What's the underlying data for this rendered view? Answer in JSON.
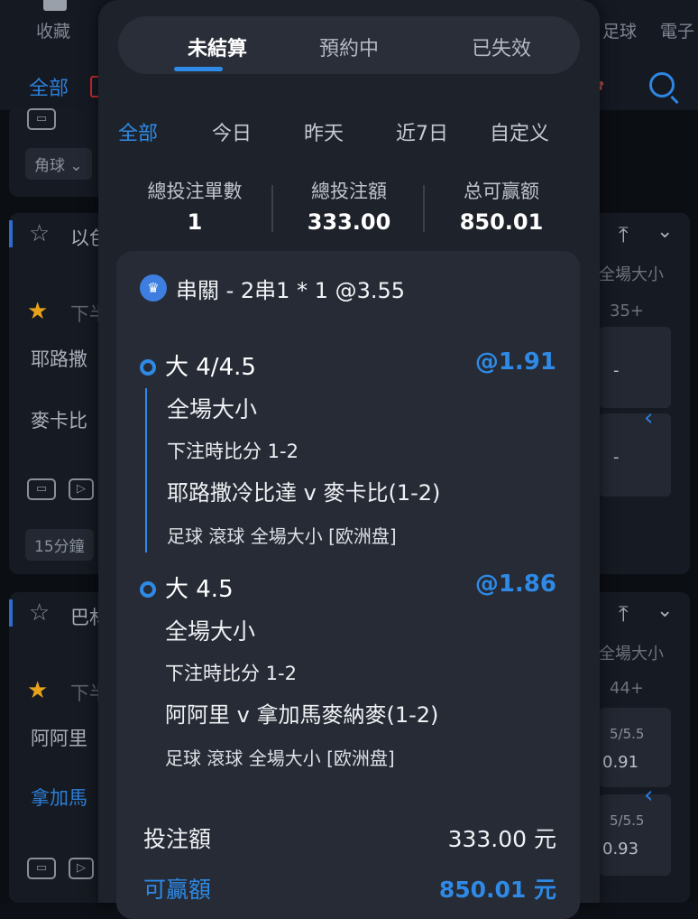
{
  "background": {
    "nav": [
      "收藏",
      "足球",
      "電子"
    ],
    "filter_all": "全部",
    "left_texts": {
      "corner": "角球",
      "team_a": "以色",
      "half1": "下半",
      "match1_home": "耶路撒",
      "match1_away": "麥卡比",
      "time": "15分鐘",
      "team_b": "巴林",
      "half2": "下半",
      "match2_home": "阿阿里",
      "match2_away": "拿加馬"
    },
    "right_texts": {
      "market1": "全場大小",
      "more1": "35+",
      "dash1": "-",
      "dash2": "-",
      "market2": "全場大小",
      "more2": "44+",
      "line1": "5/5.5",
      "odd1": "0.91",
      "line2": "5/5.5",
      "odd2": "0.93"
    }
  },
  "panel": {
    "tabs": [
      "未結算",
      "預約中",
      "已失效"
    ],
    "active_tab": 0,
    "filters": [
      "全部",
      "今日",
      "昨天",
      "近7日",
      "自定义"
    ],
    "active_filter": 0,
    "stats": [
      {
        "label": "總投注單數",
        "value": "1"
      },
      {
        "label": "總投注額",
        "value": "333.00"
      },
      {
        "label": "总可赢额",
        "value": "850.01"
      }
    ],
    "bet": {
      "title": "串關 - 2串1 * 1 @3.55",
      "legs": [
        {
          "pick": "大 4/4.5",
          "odds": "@1.91",
          "market": "全場大小",
          "score": "下注時比分 1-2",
          "match": "耶路撒冷比達 v 麥卡比(1-2)",
          "meta": "足球 滾球   全場大小 [欧洲盘]"
        },
        {
          "pick": "大 4.5",
          "odds": "@1.86",
          "market": "全場大小",
          "score": "下注時比分 1-2",
          "match": "阿阿里 v 拿加馬麥納麥(1-2)",
          "meta": "足球 滾球   全場大小 [欧洲盘]"
        }
      ],
      "stake_label": "投注額",
      "stake_value": "333.00 元",
      "win_label": "可贏額",
      "win_value": "850.01 元"
    },
    "colors": {
      "accent": "#2e8ae6",
      "panel": "#1e222b",
      "card": "#262b35"
    }
  }
}
